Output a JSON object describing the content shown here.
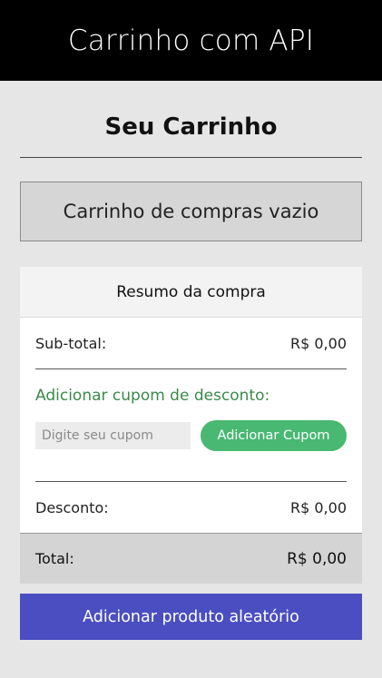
{
  "header": {
    "app_title": "Carrinho com API"
  },
  "cart": {
    "title": "Seu Carrinho",
    "empty_message": "Carrinho de compras vazio"
  },
  "summary": {
    "header": "Resumo da compra",
    "subtotal_label": "Sub-total:",
    "subtotal_value": "R$ 0,00",
    "coupon_title": "Adicionar cupom de desconto:",
    "coupon_placeholder": "Digite seu cupom",
    "coupon_button_label": "Adicionar Cupom",
    "discount_label": "Desconto:",
    "discount_value": "R$ 0,00",
    "total_label": "Total:",
    "total_value": "R$ 0,00"
  },
  "actions": {
    "random_product_label": "Adicionar produto aleatório"
  },
  "colors": {
    "header_bg": "#000000",
    "page_bg": "#e6e6e6",
    "coupon_accent": "#3a8a4a",
    "coupon_button": "#48b872",
    "primary_button": "#4b4ec0"
  }
}
